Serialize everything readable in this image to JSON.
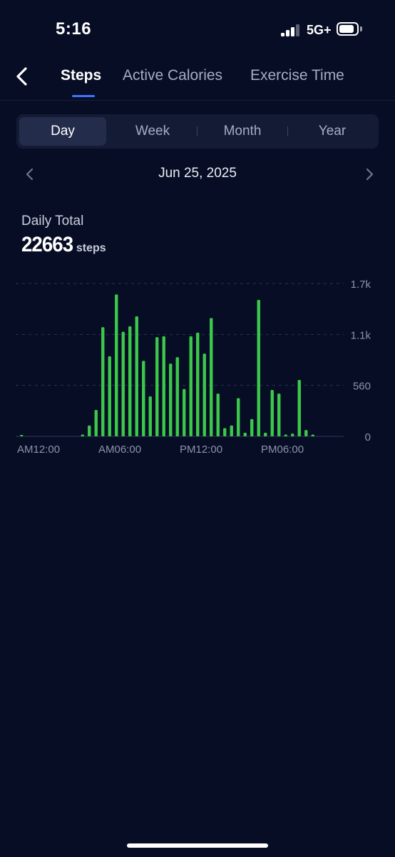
{
  "status_bar": {
    "time": "5:16",
    "network": "5G+",
    "signal_bars_active": 3,
    "signal_bars_total": 4,
    "battery_level": 0.85
  },
  "header": {
    "tabs": [
      {
        "label": "Steps",
        "active": true
      },
      {
        "label": "Active Calories",
        "active": false
      },
      {
        "label": "Exercise Time",
        "active": false
      }
    ]
  },
  "range_selector": {
    "options": [
      "Day",
      "Week",
      "Month",
      "Year"
    ],
    "selected": "Day"
  },
  "date_nav": {
    "date": "Jun 25, 2025"
  },
  "summary": {
    "caption": "Daily Total",
    "value": "22663",
    "unit": "steps"
  },
  "colors": {
    "background": "#070d24",
    "bar": "#3cc84b",
    "accent": "#3d74ff",
    "grid": "#2a3350",
    "axis_text": "#8b93ad"
  },
  "chart_data": {
    "type": "bar",
    "x_range_hours": [
      0,
      24
    ],
    "bar_interval_minutes": 30,
    "x_tick_labels": [
      "AM12:00",
      "AM06:00",
      "PM12:00",
      "PM06:00"
    ],
    "x_tick_hours": [
      0,
      6,
      12,
      18
    ],
    "y_tick_labels": [
      "0",
      "560",
      "1.1k",
      "1.7k"
    ],
    "y_tick_values": [
      0,
      560,
      1120,
      1680
    ],
    "ylim": [
      0,
      1680
    ],
    "grid": true,
    "x": [
      0.0,
      4.5,
      5.0,
      5.5,
      6.0,
      6.5,
      7.0,
      7.5,
      8.0,
      8.5,
      9.0,
      9.5,
      10.0,
      10.5,
      11.0,
      11.5,
      12.0,
      12.5,
      13.0,
      13.5,
      14.0,
      14.5,
      15.0,
      15.5,
      16.0,
      16.5,
      17.0,
      17.5,
      18.0,
      18.5,
      19.0,
      19.5,
      20.0,
      20.5,
      21.0,
      21.5
    ],
    "values": [
      15,
      20,
      120,
      290,
      1200,
      880,
      1560,
      1150,
      1210,
      1320,
      830,
      440,
      1090,
      1100,
      800,
      870,
      520,
      1100,
      1140,
      910,
      1300,
      470,
      90,
      120,
      420,
      40,
      190,
      1500,
      40,
      510,
      470,
      20,
      30,
      620,
      70,
      20
    ]
  }
}
